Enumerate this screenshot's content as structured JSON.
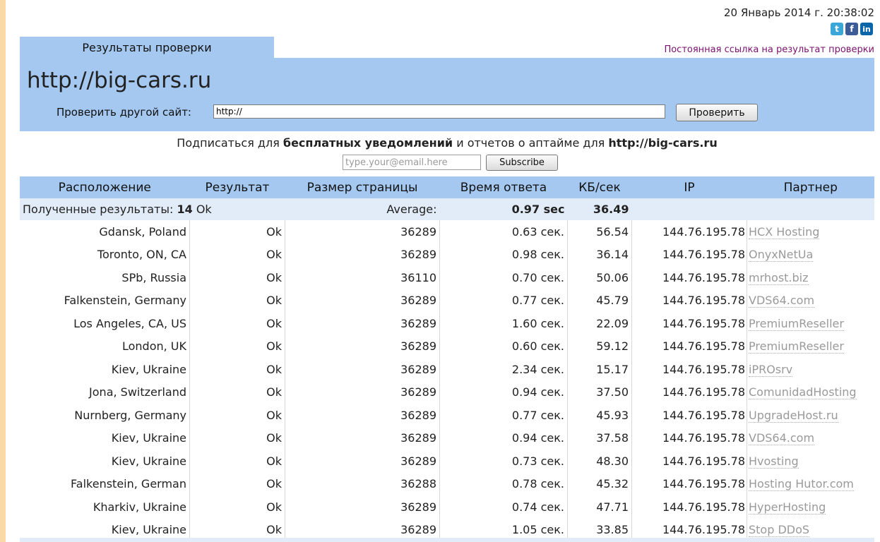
{
  "header": {
    "datetime": "20 Январь 2014 г. 20:38:02",
    "social": [
      "t",
      "f",
      "in"
    ],
    "tab_label": "Результаты проверки",
    "permalink": "Постоянная ссылка на результат проверки"
  },
  "site": {
    "url": "http://big-cars.ru",
    "check_label": "Проверить другой сайт:",
    "check_input_value": "http://",
    "check_button": "Проверить"
  },
  "subscribe": {
    "prefix": "Подписаться для ",
    "bold1": "бесплатных уведомлений",
    "middle": " и отчетов о аптайме для ",
    "bold2": "http://big-cars.ru",
    "email_placeholder": "type.your@email.here",
    "button": "Subscribe"
  },
  "table": {
    "headers": [
      "Расположение",
      "Результат",
      "Размер страницы",
      "Время ответа",
      "КБ/сек",
      "IP",
      "Партнер"
    ],
    "summary": {
      "label": "Полученные результаты: ",
      "count": "14",
      "status": " Ok",
      "average_label": "Average:",
      "average_time": "0.97 sec",
      "average_kb": "36.49"
    },
    "rows": [
      {
        "location": "Gdansk, Poland",
        "result": "Ok",
        "size": "36289",
        "time": "0.63 сек.",
        "kb": "56.54",
        "ip": "144.76.195.78",
        "partner": "HCX Hosting"
      },
      {
        "location": "Toronto, ON, CA",
        "result": "Ok",
        "size": "36289",
        "time": "0.98 сек.",
        "kb": "36.14",
        "ip": "144.76.195.78",
        "partner": "OnyxNetUa"
      },
      {
        "location": "SPb, Russia",
        "result": "Ok",
        "size": "36110",
        "time": "0.70 сек.",
        "kb": "50.06",
        "ip": "144.76.195.78",
        "partner": "mrhost.biz"
      },
      {
        "location": "Falkenstein, Germany",
        "result": "Ok",
        "size": "36289",
        "time": "0.77 сек.",
        "kb": "45.79",
        "ip": "144.76.195.78",
        "partner": "VDS64.com"
      },
      {
        "location": "Los Angeles, CA, US",
        "result": "Ok",
        "size": "36289",
        "time": "1.60 сек.",
        "kb": "22.09",
        "ip": "144.76.195.78",
        "partner": "PremiumReseller"
      },
      {
        "location": "London, UK",
        "result": "Ok",
        "size": "36289",
        "time": "0.60 сек.",
        "kb": "59.12",
        "ip": "144.76.195.78",
        "partner": "PremiumReseller"
      },
      {
        "location": "Kiev, Ukraine",
        "result": "Ok",
        "size": "36289",
        "time": "2.34 сек.",
        "kb": "15.17",
        "ip": "144.76.195.78",
        "partner": "iPROsrv"
      },
      {
        "location": "Jona, Switzerland",
        "result": "Ok",
        "size": "36289",
        "time": "0.94 сек.",
        "kb": "37.50",
        "ip": "144.76.195.78",
        "partner": "ComunidadHosting"
      },
      {
        "location": "Nurnberg, Germany",
        "result": "Ok",
        "size": "36289",
        "time": "0.77 сек.",
        "kb": "45.93",
        "ip": "144.76.195.78",
        "partner": "UpgradeHost.ru"
      },
      {
        "location": "Kiev, Ukraine",
        "result": "Ok",
        "size": "36289",
        "time": "0.94 сек.",
        "kb": "37.58",
        "ip": "144.76.195.78",
        "partner": "VDS64.com"
      },
      {
        "location": "Kiev, Ukraine",
        "result": "Ok",
        "size": "36289",
        "time": "0.73 сек.",
        "kb": "48.30",
        "ip": "144.76.195.78",
        "partner": "Hvosting"
      },
      {
        "location": "Falkenstein, German",
        "result": "Ok",
        "size": "36288",
        "time": "0.78 сек.",
        "kb": "45.32",
        "ip": "144.76.195.78",
        "partner": "Hosting Hutor.com"
      },
      {
        "location": "Kharkiv, Ukraine",
        "result": "Ok",
        "size": "36289",
        "time": "0.74 сек.",
        "kb": "47.71",
        "ip": "144.76.195.78",
        "partner": "HyperHosting"
      },
      {
        "location": "Kiev, Ukraine",
        "result": "Ok",
        "size": "36289",
        "time": "1.05 сек.",
        "kb": "33.85",
        "ip": "144.76.195.78",
        "partner": "Stop DDoS"
      }
    ]
  }
}
